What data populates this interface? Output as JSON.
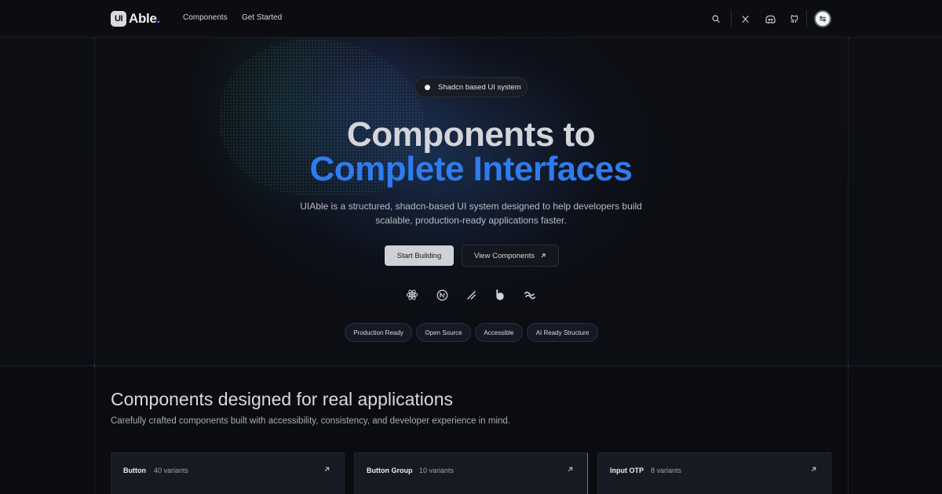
{
  "nav": {
    "logo_mark": "UI",
    "logo_text": "Able",
    "logo_dot": ".",
    "links": [
      "Components",
      "Get Started"
    ],
    "icons": [
      "search-icon",
      "x-twitter-icon",
      "discord-icon",
      "github-icon",
      "theme-toggle-icon"
    ]
  },
  "hero": {
    "pill": "Shadcn based UI system",
    "title_line1": "Components to",
    "title_line2": "Complete Interfaces",
    "subtitle": "UIAble is a structured, shadcn-based UI system designed to help developers build scalable, production-ready applications faster.",
    "primary_button": "Start Building",
    "secondary_button": "View Components",
    "tech_icons": [
      "react-icon",
      "nextjs-icon",
      "shadcn-icon",
      "bootstrap-icon",
      "tailwind-icon"
    ],
    "tags": [
      "Production Ready",
      "Open Source",
      "Accessible",
      "AI Ready Structure"
    ]
  },
  "section": {
    "title": "Components designed for real applications",
    "subtitle": "Carefully crafted components built with accessibility, consistency, and developer experience in mind."
  },
  "cards": [
    {
      "title": "Button",
      "count": "40 variants"
    },
    {
      "title": "Button Group",
      "count": "10 variants"
    },
    {
      "title": "Input OTP",
      "count": "8 variants"
    }
  ],
  "colors": {
    "accent": "#2f7bf0",
    "background": "#0b0c10"
  }
}
